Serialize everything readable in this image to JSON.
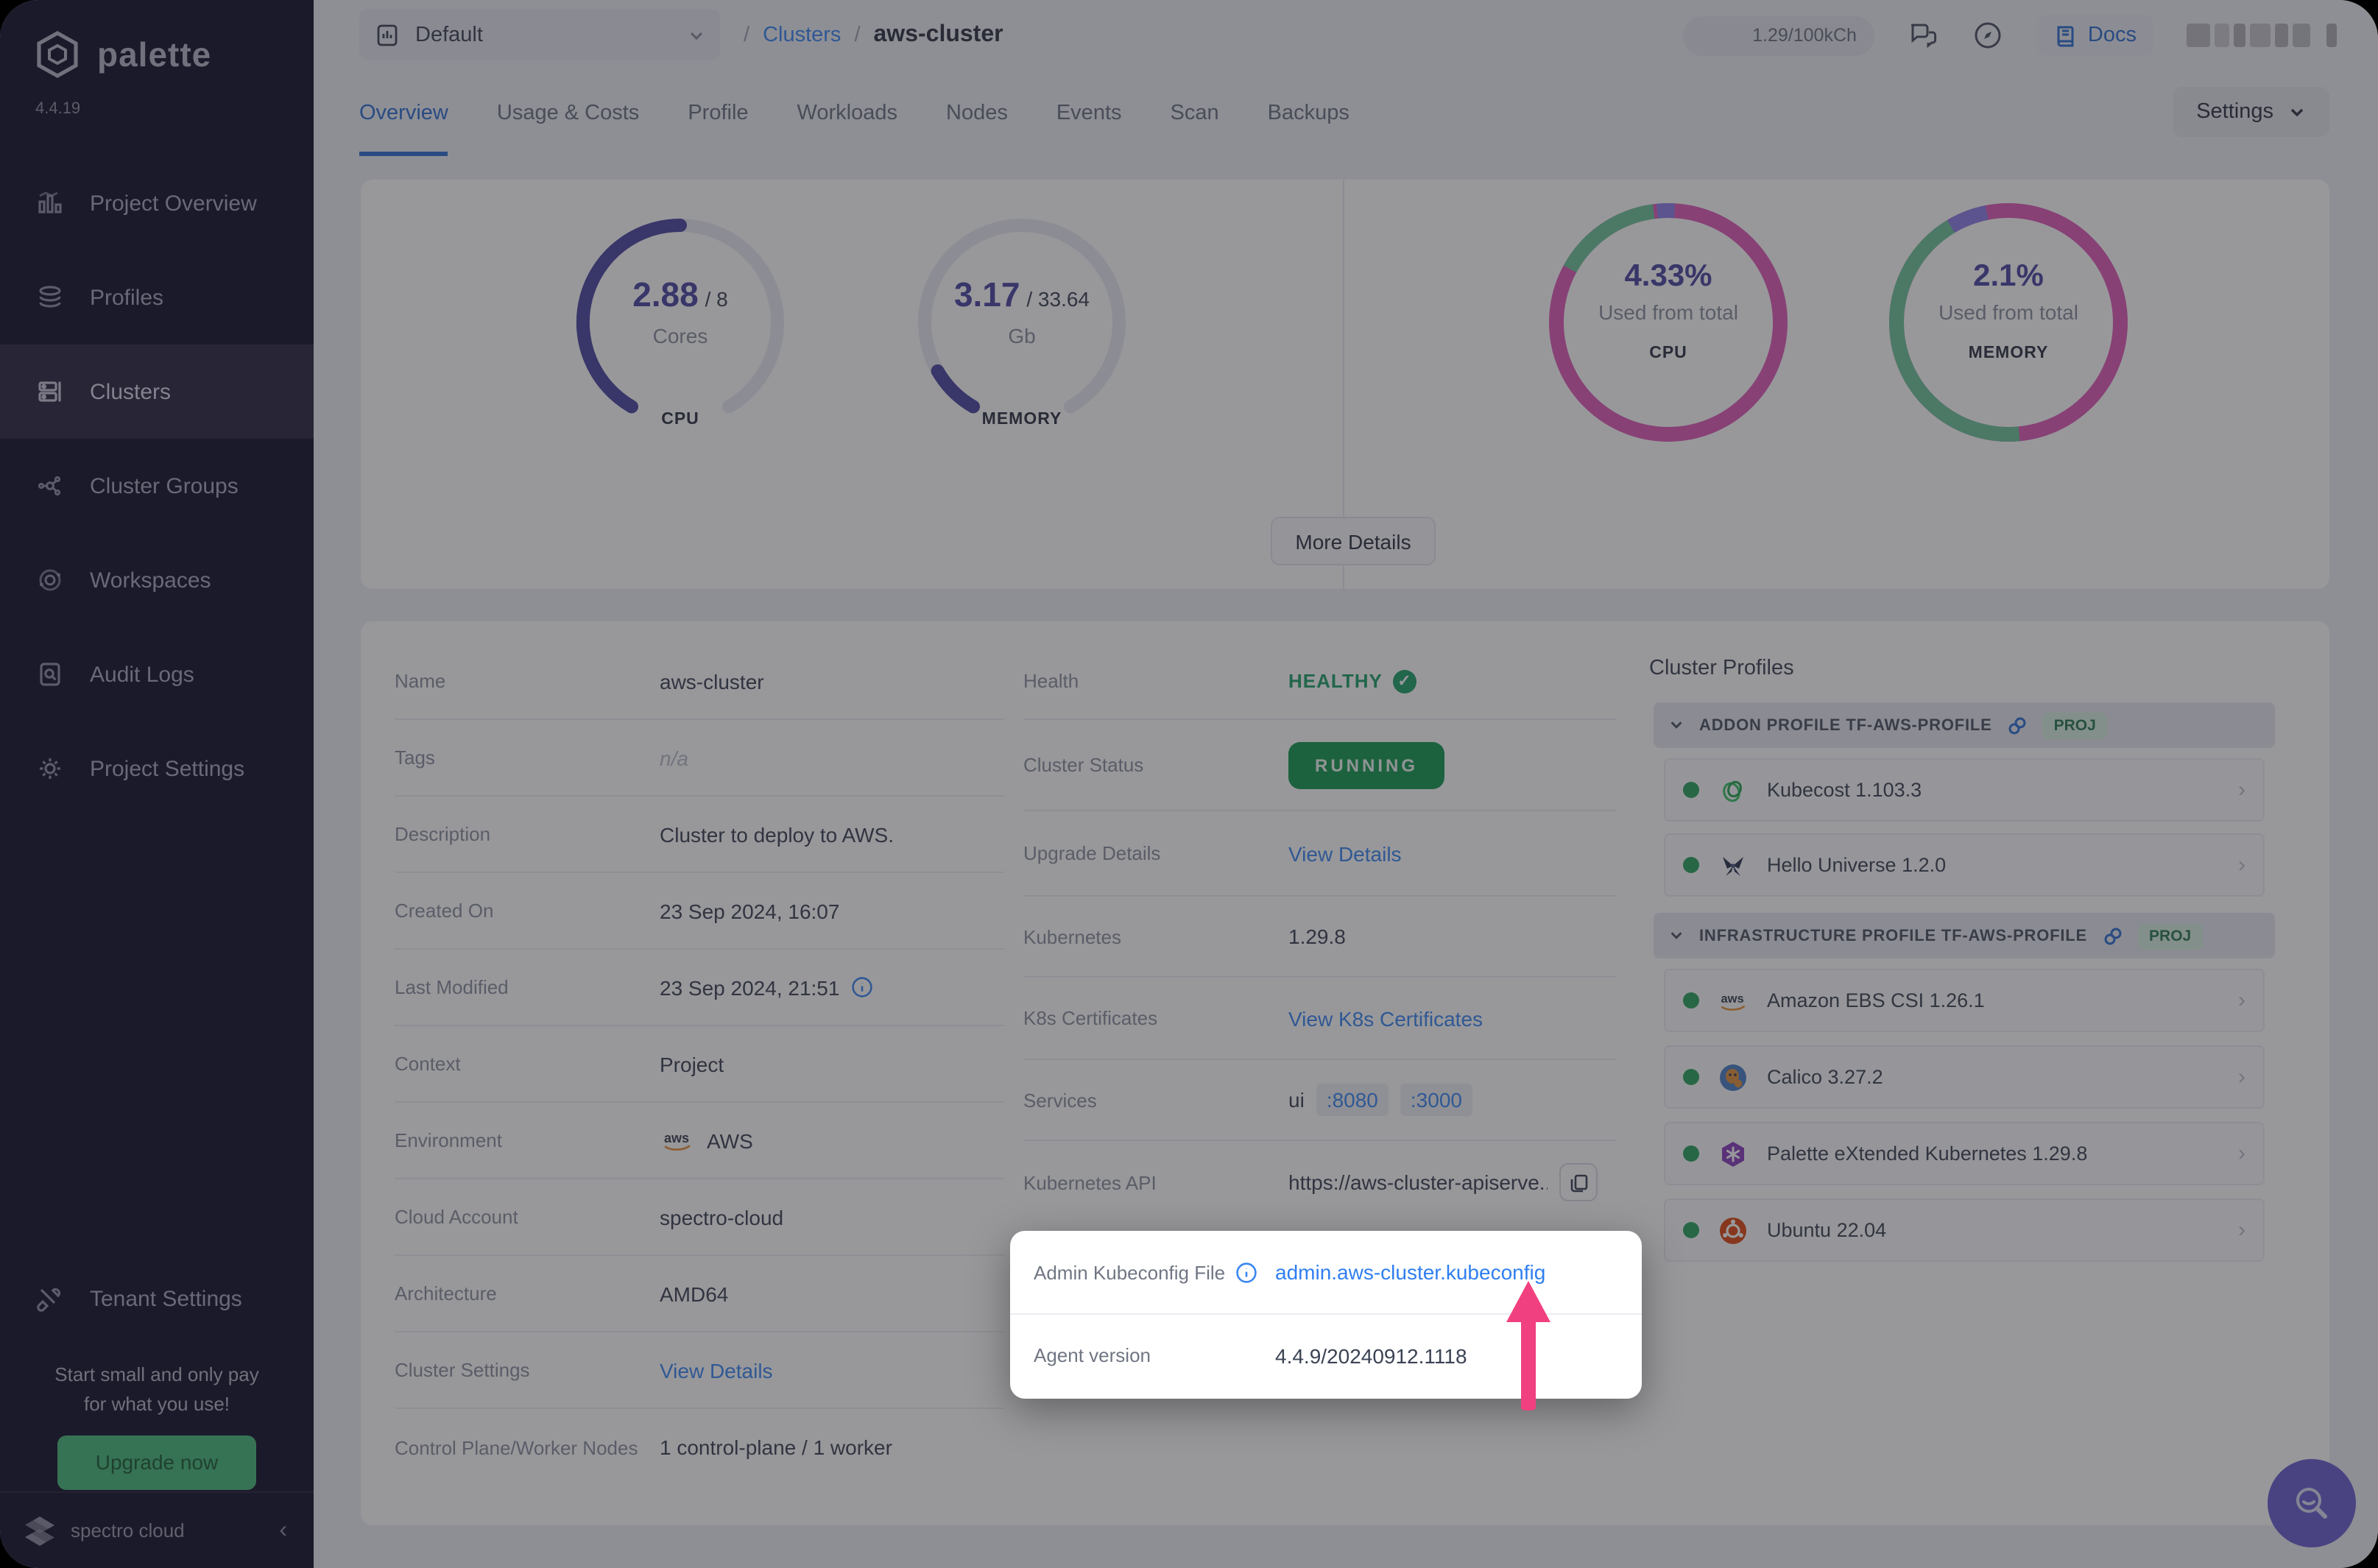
{
  "window": {
    "brand": "palette",
    "version": "4.4.19"
  },
  "sidebar": {
    "items": [
      {
        "label": "Project Overview"
      },
      {
        "label": "Profiles"
      },
      {
        "label": "Clusters"
      },
      {
        "label": "Cluster Groups"
      },
      {
        "label": "Workspaces"
      },
      {
        "label": "Audit Logs"
      },
      {
        "label": "Project Settings"
      }
    ],
    "tenant_settings": "Tenant Settings",
    "promo": {
      "line1": "Start small and only pay",
      "line2": "for what you use!",
      "button": "Upgrade now"
    },
    "footer_brand": "spectro cloud"
  },
  "topbar": {
    "project_selector": "Default",
    "breadcrumb": {
      "sep1": "/",
      "parent": "Clusters",
      "sep2": "/",
      "current": "aws-cluster"
    },
    "usage_pill": "1.29/100kCh",
    "docs_label": "Docs"
  },
  "tabs": {
    "items": [
      "Overview",
      "Usage & Costs",
      "Profile",
      "Workloads",
      "Nodes",
      "Events",
      "Scan",
      "Backups"
    ],
    "settings_button": "Settings"
  },
  "usage_card": {
    "cpu_gauge": {
      "used": "2.88",
      "total": "/ 8",
      "unit": "Cores",
      "label": "CPU"
    },
    "memory_gauge": {
      "used": "3.17",
      "total": "/ 33.64",
      "unit": "Gb",
      "label": "MEMORY"
    },
    "cpu_donut": {
      "value": "4.33%",
      "caption": "Used from total",
      "label": "CPU"
    },
    "memory_donut": {
      "value": "2.1%",
      "caption": "Used from total",
      "label": "MEMORY"
    },
    "more_details": "More Details"
  },
  "details_left": [
    {
      "label": "Name",
      "value": "aws-cluster"
    },
    {
      "label": "Tags",
      "value": "n/a"
    },
    {
      "label": "Description",
      "value": "Cluster to deploy to AWS."
    },
    {
      "label": "Created On",
      "value": "23 Sep 2024, 16:07"
    },
    {
      "label": "Last Modified",
      "value": "23 Sep 2024, 21:51"
    },
    {
      "label": "Context",
      "value": "Project"
    },
    {
      "label": "Environment",
      "value": "AWS"
    },
    {
      "label": "Cloud Account",
      "value": "spectro-cloud"
    },
    {
      "label": "Architecture",
      "value": "AMD64"
    },
    {
      "label": "Cluster Settings",
      "value": "View Details"
    },
    {
      "label": "Control Plane/Worker Nodes",
      "value": "1 control-plane / 1 worker"
    }
  ],
  "details_right": {
    "health_label": "Health",
    "health_value": "HEALTHY",
    "status_label": "Cluster Status",
    "status_value": "RUNNING",
    "upgrade_label": "Upgrade Details",
    "upgrade_value": "View Details",
    "k8s_label": "Kubernetes",
    "k8s_value": "1.29.8",
    "cert_label": "K8s Certificates",
    "cert_value": "View K8s Certificates",
    "services_label": "Services",
    "services_prefix": "ui",
    "port1": ":8080",
    "port2": ":3000",
    "api_label": "Kubernetes API",
    "api_value": "https://aws-cluster-apiserve..."
  },
  "spotlight": {
    "label": "Admin Kubeconfig File",
    "link": "admin.aws-cluster.kubeconfig",
    "row2_label": "Agent version",
    "row2_value": "4.4.9/20240912.1118"
  },
  "cluster_profiles": {
    "title": "Cluster Profiles",
    "groups": [
      {
        "header": "ADDON PROFILE TF-AWS-PROFILE",
        "badge": "PROJ",
        "items": [
          {
            "name": "Kubecost 1.103.3"
          },
          {
            "name": "Hello Universe 1.2.0"
          }
        ]
      },
      {
        "header": "INFRASTRUCTURE PROFILE TF-AWS-PROFILE",
        "badge": "PROJ",
        "items": [
          {
            "name": "Amazon EBS CSI 1.26.1"
          },
          {
            "name": "Calico 3.27.2"
          },
          {
            "name": "Palette eXtended Kubernetes 1.29.8"
          },
          {
            "name": "Ubuntu 22.04"
          }
        ]
      }
    ]
  },
  "colors": {
    "accent_blue": "#3b86f0",
    "magenta": "#df5cb8",
    "green": "#2aa25f",
    "indigo": "#4c46a0",
    "arrow_pink": "#f1407f",
    "sidebar_bg": "#14112a"
  }
}
